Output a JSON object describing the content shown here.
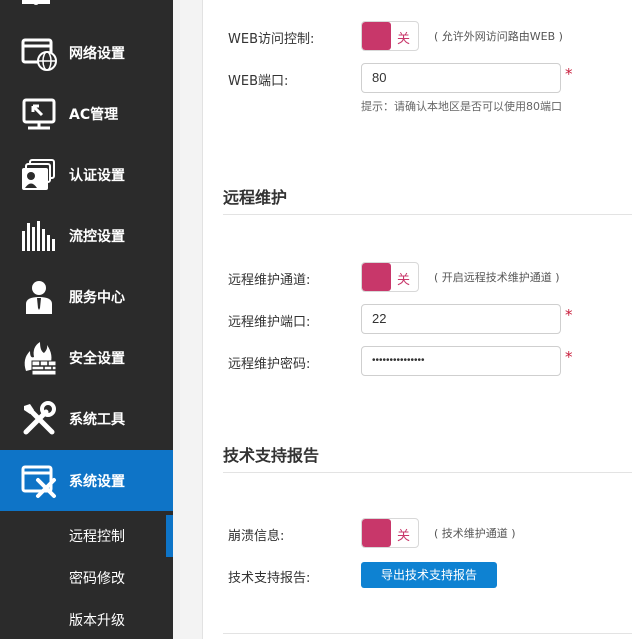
{
  "sidebar": {
    "items": [
      {
        "label": "网络设置",
        "icon": "network-globe-icon"
      },
      {
        "label": "AC管理",
        "icon": "ac-monitor-icon"
      },
      {
        "label": "认证设置",
        "icon": "auth-card-icon"
      },
      {
        "label": "流控设置",
        "icon": "traffic-bars-icon"
      },
      {
        "label": "服务中心",
        "icon": "service-person-icon"
      },
      {
        "label": "安全设置",
        "icon": "firewall-icon"
      },
      {
        "label": "系统工具",
        "icon": "tools-icon"
      },
      {
        "label": "系统设置",
        "icon": "system-settings-icon"
      }
    ],
    "sub_items": [
      {
        "label": "远程控制"
      },
      {
        "label": "密码修改"
      },
      {
        "label": "版本升级"
      }
    ],
    "colors": {
      "bg": "#2b2b2b",
      "active": "#0e74c7"
    }
  },
  "web": {
    "access_label": "WEB访问控制:",
    "access_toggle": "关",
    "access_hint": "( 允许外网访问路由WEB )",
    "port_label": "WEB端口:",
    "port_value": "80",
    "port_required": "*",
    "port_tip": "提示：请确认本地区是否可以使用80端口"
  },
  "remote": {
    "title": "远程维护",
    "channel_label": "远程维护通道:",
    "channel_toggle": "关",
    "channel_hint": "( 开启远程技术维护通道 )",
    "port_label": "远程维护端口:",
    "port_value": "22",
    "port_required": "*",
    "password_label": "远程维护密码:",
    "password_value": "•••••••••••••••",
    "password_required": "*"
  },
  "support": {
    "title": "技术支持报告",
    "crash_label": "崩溃信息:",
    "crash_toggle": "关",
    "crash_hint": "( 技术维护通道 )",
    "report_label": "技术支持报告:",
    "export_button": "导出技术支持报告"
  },
  "colors": {
    "toggle": "#c8376a",
    "button": "#0e82d2",
    "required": "#c81e3c"
  }
}
